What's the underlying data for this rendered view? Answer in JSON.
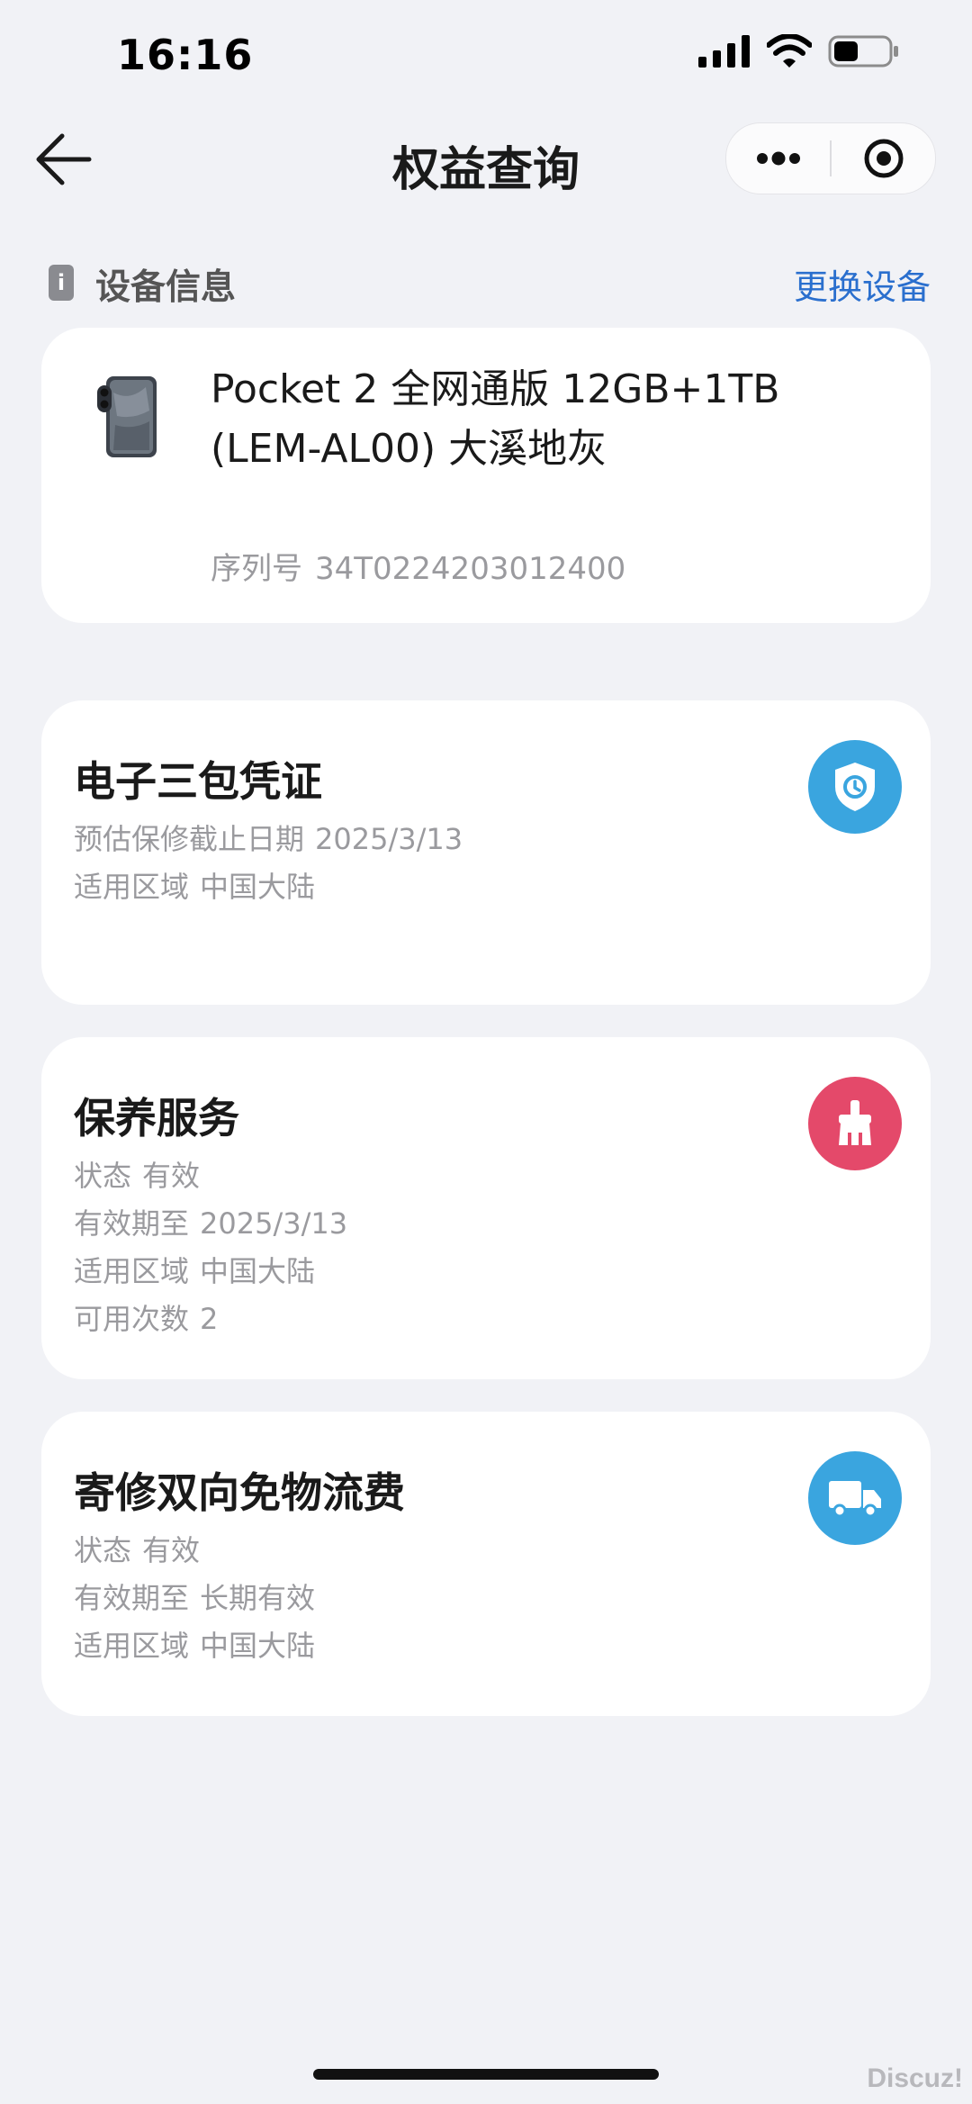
{
  "status_bar": {
    "time": "16:16"
  },
  "nav": {
    "title": "权益查询"
  },
  "section": {
    "badge": "i",
    "title": "设备信息",
    "action": "更换设备"
  },
  "device": {
    "name": "Pocket 2 全网通版 12GB+1TB (LEM-AL00) 大溪地灰",
    "serial_label": "序列号",
    "serial": "34T0224203012400"
  },
  "benefits": [
    {
      "title": "电子三包凭证",
      "icon": "shield-clock-icon",
      "icon_color": "#3aa5df",
      "lines": [
        {
          "label": "预估保修截止日期",
          "value": "2025/3/13"
        },
        {
          "label": "适用区域",
          "value": "中国大陆"
        }
      ]
    },
    {
      "title": "保养服务",
      "icon": "brush-icon",
      "icon_color": "#e4496a",
      "lines": [
        {
          "label": "状态",
          "value": "有效"
        },
        {
          "label": "有效期至",
          "value": "2025/3/13"
        },
        {
          "label": "适用区域",
          "value": "中国大陆"
        },
        {
          "label": "可用次数",
          "value": "2"
        }
      ]
    },
    {
      "title": "寄修双向免物流费",
      "icon": "truck-icon",
      "icon_color": "#3aa5df",
      "lines": [
        {
          "label": "状态",
          "value": "有效"
        },
        {
          "label": "有效期至",
          "value": "长期有效"
        },
        {
          "label": "适用区域",
          "value": "中国大陆"
        }
      ]
    }
  ],
  "watermark": "Discuz!"
}
